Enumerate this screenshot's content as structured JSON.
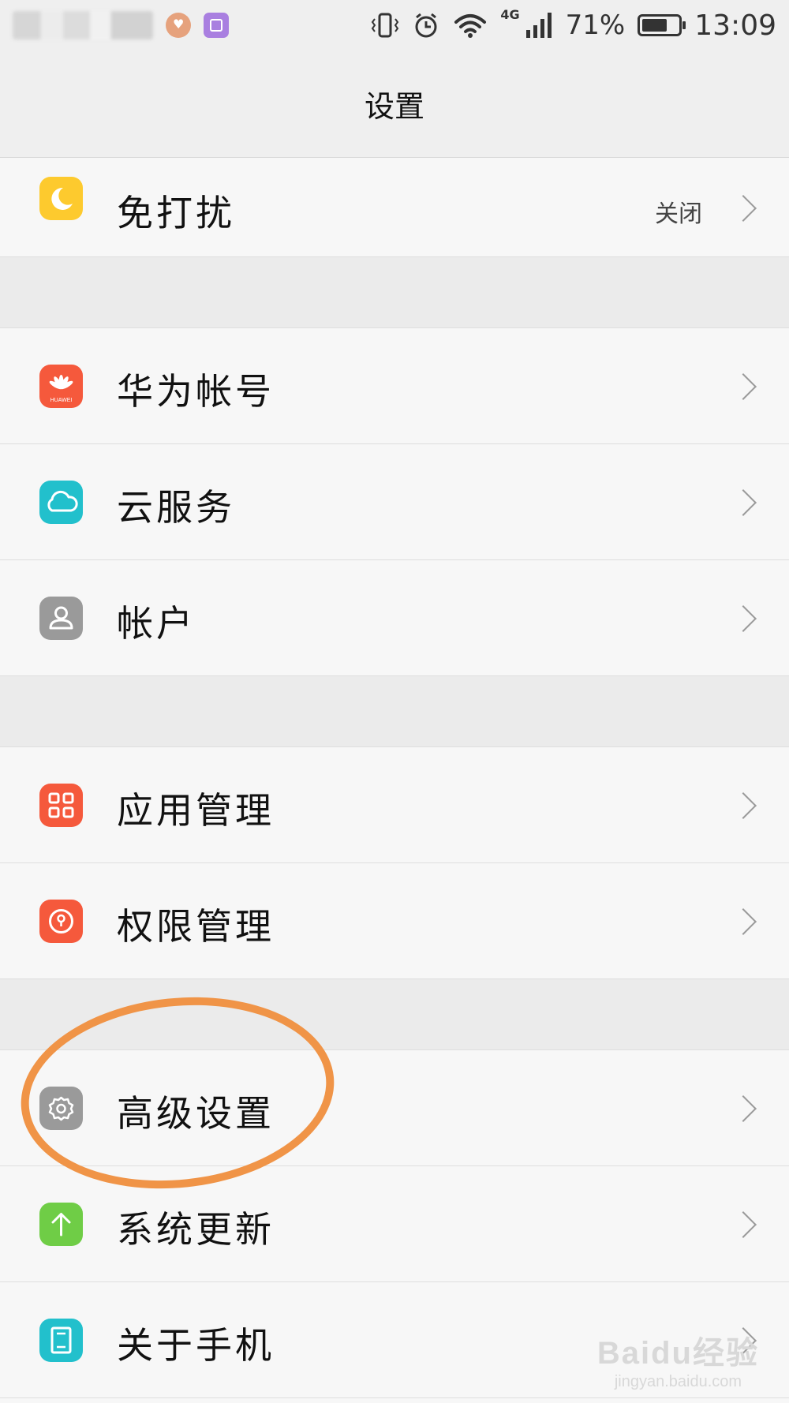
{
  "status_bar": {
    "notifications": [
      "avatar-notification-icon",
      "gallery-icon"
    ],
    "icons": [
      "vibrate-icon",
      "alarm-icon",
      "wifi-icon",
      "signal-icon"
    ],
    "network_type": "4G",
    "battery_percent": "71%",
    "battery_level": 0.71,
    "time": "13:09"
  },
  "header": {
    "title": "设置"
  },
  "rows": [
    {
      "label": "免打扰",
      "value": "关闭",
      "icon": "moon-icon",
      "color": "#fdca2e"
    },
    {
      "label": "华为帐号",
      "icon": "huawei-logo-icon",
      "icon_text": "HUAWEI",
      "color": "#f5593c"
    },
    {
      "label": "云服务",
      "icon": "cloud-icon",
      "color": "#22c0cc"
    },
    {
      "label": "帐户",
      "icon": "person-icon",
      "color": "#9a9a9a"
    },
    {
      "label": "应用管理",
      "icon": "apps-grid-icon",
      "color": "#f5593c"
    },
    {
      "label": "权限管理",
      "icon": "permission-lock-icon",
      "color": "#f5593c"
    },
    {
      "label": "高级设置",
      "icon": "gear-icon",
      "color": "#9a9a9a"
    },
    {
      "label": "系统更新",
      "icon": "arrow-up-icon",
      "color": "#6fcd46"
    },
    {
      "label": "关于手机",
      "icon": "phone-info-icon",
      "color": "#22c0cc"
    }
  ],
  "annotation": {
    "color": "#f09447",
    "target": "高级设置"
  },
  "watermark": {
    "logo": "Baidu经验",
    "url": "jingyan.baidu.com"
  }
}
